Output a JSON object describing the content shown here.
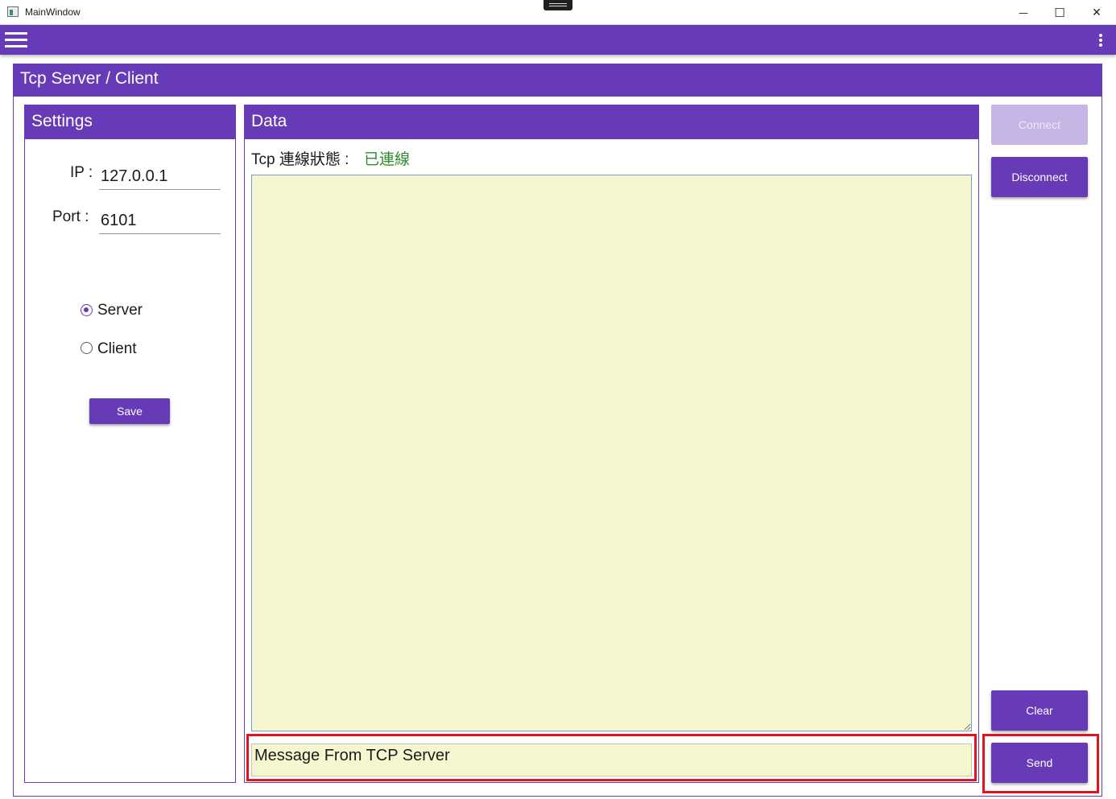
{
  "window": {
    "title": "MainWindow",
    "minimize_glyph": "—",
    "maximize_glyph": "☐",
    "close_glyph": "✕"
  },
  "appbar": {
    "menu_icon": "hamburger-menu-icon",
    "more_icon": "more-vertical-icon",
    "color": "#673ab7"
  },
  "main": {
    "title": "Tcp Server / Client"
  },
  "settings": {
    "title": "Settings",
    "ip_label": "IP :",
    "ip_value": "127.0.0.1",
    "port_label": "Port :",
    "port_value": "6101",
    "modes": [
      {
        "label": "Server",
        "selected": true
      },
      {
        "label": "Client",
        "selected": false
      }
    ],
    "save_label": "Save"
  },
  "data": {
    "title": "Data",
    "status_label": "Tcp 連線狀態 :",
    "status_value": "已連線",
    "status_color": "#2e8b2e",
    "log_text": "",
    "message_value": "Message From TCP Server"
  },
  "actions": {
    "connect_label": "Connect",
    "connect_enabled": false,
    "disconnect_label": "Disconnect",
    "clear_label": "Clear",
    "send_label": "Send"
  },
  "highlight_color": "#e0141e"
}
